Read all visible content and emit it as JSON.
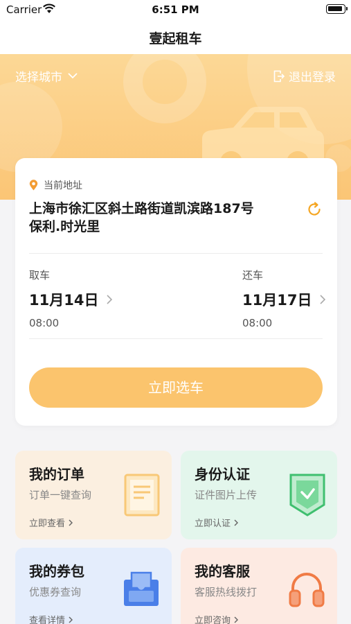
{
  "status_bar": {
    "carrier": "Carrier",
    "time": "6:51 PM"
  },
  "nav": {
    "title": "壹起租车"
  },
  "header": {
    "city_label": "选择城市",
    "logout_label": "退出登录"
  },
  "booking": {
    "address_label": "当前地址",
    "address_line1": "上海市徐汇区斜土路街道凯滨路187号",
    "address_line2": "保利.时光里",
    "pickup": {
      "label": "取车",
      "date": "11月14日",
      "time": "08:00"
    },
    "return": {
      "label": "还车",
      "date": "11月17日",
      "time": "08:00"
    },
    "cta_label": "立即选车"
  },
  "tiles": [
    {
      "title": "我的订单",
      "subtitle": "订单一键查询",
      "link": "立即查看",
      "icon": "order-document-icon"
    },
    {
      "title": "身份认证",
      "subtitle": "证件图片上传",
      "link": "立即认证",
      "icon": "shield-check-icon"
    },
    {
      "title": "我的券包",
      "subtitle": "优惠券查询",
      "link": "查看详情",
      "icon": "coupon-wallet-icon"
    },
    {
      "title": "我的客服",
      "subtitle": "客服热线拨打",
      "link": "立即咨询",
      "icon": "headset-icon"
    }
  ],
  "colors": {
    "accent": "#fbc46d",
    "hero": "#fcd896",
    "location_pin": "#f39c33"
  }
}
